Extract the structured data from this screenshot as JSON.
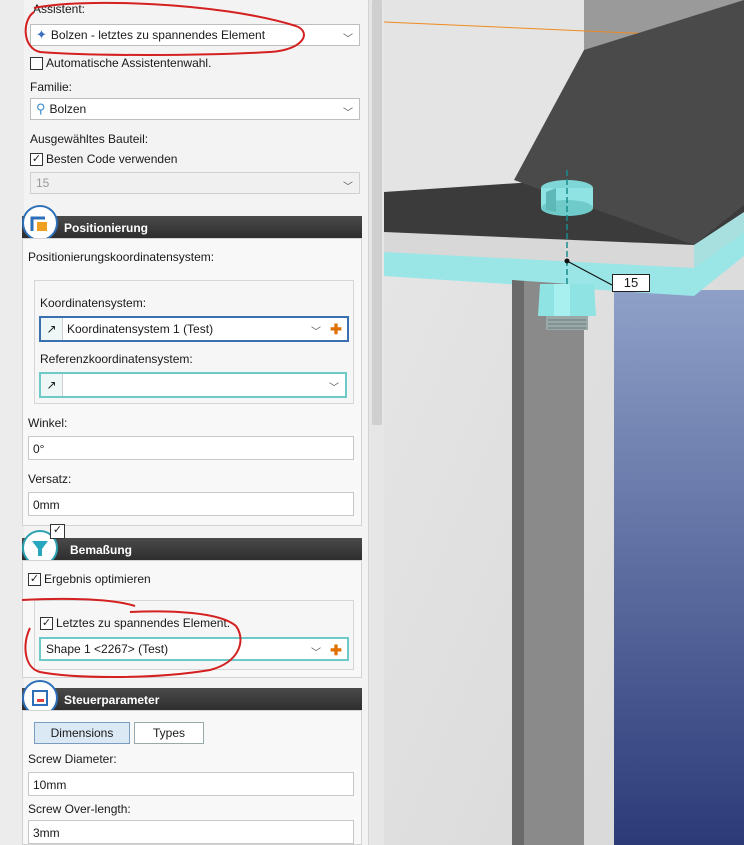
{
  "assistant": {
    "label": "Assistent:",
    "selected": "Bolzen - letztes zu spannendes Element",
    "auto_checkbox": "Automatische Assistentenwahl."
  },
  "family": {
    "label": "Familie:",
    "selected": "Bolzen"
  },
  "component": {
    "label": "Ausgewähltes Bauteil:",
    "best_code_checkbox": "Besten Code verwenden",
    "code_value": "15"
  },
  "positioning": {
    "title": "Positionierung",
    "system_label": "Positionierungskoordinatensystem:",
    "coord_label": "Koordinatensystem:",
    "coord_value": "Koordinatensystem 1 (Test)",
    "ref_coord_label": "Referenzkoordinatensystem:",
    "ref_coord_value": "",
    "angle_label": "Winkel:",
    "angle_value": "0°",
    "offset_label": "Versatz:",
    "offset_value": "0mm"
  },
  "dimensioning": {
    "title": "Bemaßung",
    "optimize_checkbox": "Ergebnis optimieren",
    "last_element_checkbox": "Letztes zu spannendes Element:",
    "last_element_value": "Shape 1 <2267> (Test)"
  },
  "control": {
    "title": "Steuerparameter",
    "tabs": [
      "Dimensions",
      "Types"
    ],
    "screw_diameter_label": "Screw Diameter:",
    "screw_diameter_value": "10mm",
    "screw_overlength_label": "Screw Over-length:",
    "screw_overlength_value": "3mm"
  },
  "viewport": {
    "dimension_label": "15"
  },
  "colors": {
    "annotation_red": "#d42020",
    "bolt_cyan": "#8fe3e3",
    "header_dark": "#333333",
    "accent_orange": "#e07000"
  }
}
